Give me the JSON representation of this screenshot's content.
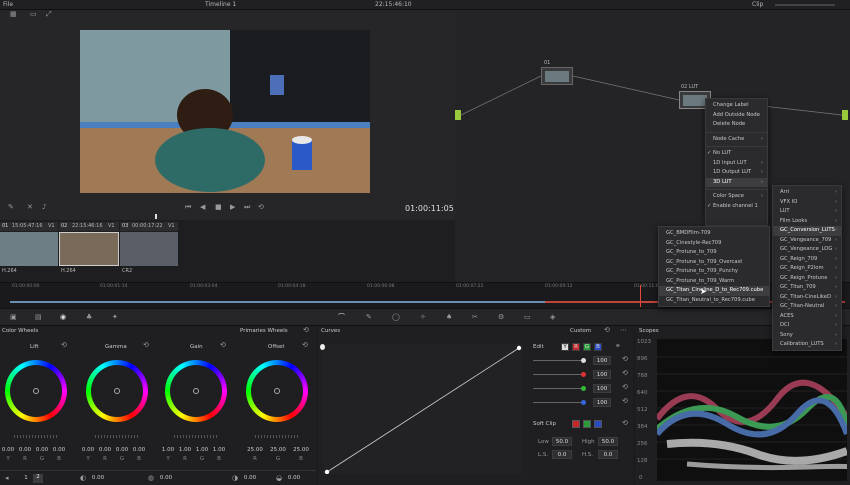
{
  "topbar": {
    "menu_label": "File",
    "timeline_title": "Timeline 1",
    "timecode": "22:15:46:10",
    "clip_label": "Clip"
  },
  "viewer": {
    "timecode": "01:00:11:05"
  },
  "nodes": {
    "node1_label": "01",
    "node2_label": "02 LUT"
  },
  "context_menu": {
    "items": [
      {
        "label": "Change Label",
        "sub": false
      },
      {
        "label": "Add Outside Node",
        "sub": false
      },
      {
        "label": "Delete Node",
        "sub": false
      },
      {
        "label": "Node Cache",
        "sub": true
      },
      {
        "label": "No LUT",
        "sub": false,
        "checked": true
      },
      {
        "label": "1D Input LUT",
        "sub": true
      },
      {
        "label": "1D Output LUT",
        "sub": true
      },
      {
        "label": "3D LUT",
        "sub": true
      },
      {
        "label": "Color Space",
        "sub": true
      },
      {
        "label": "Enable channel 1",
        "sub": false,
        "checked": true
      }
    ]
  },
  "lut_menu": {
    "items": [
      "Arri",
      "VFX IO",
      "LUT",
      "Film Looks",
      "GC_Conversion_LUTS",
      "GC_Vengeance_709",
      "GC_Vengeance_LOG",
      "GC_Reign_709",
      "GC_Reign_P2lom",
      "GC_Reign_Protune",
      "GC_Titan_709",
      "GC_Titan-CineLikeD",
      "GC_Titan-Neutral",
      "ACES",
      "DCI",
      "Sony",
      "Calibration_LUTS"
    ]
  },
  "cube_menu": {
    "items": [
      "GC_BMDFilm-709",
      "GC_Cinestyle-Rec709",
      "GC_Protune_to_709",
      "GC_Protune_to_709_Overcast",
      "GC_Protune_to_709_Punchy",
      "GC_Protune_to_709_Warm",
      "GC_Titan_Cineline_D_to_Rec709.cube",
      "GC_Titan_Neutral_to_Rec709.cube"
    ]
  },
  "clips": [
    {
      "num": "01",
      "tc": "15:05:47:16",
      "track": "V1",
      "codec": "H.264"
    },
    {
      "num": "02",
      "tc": "22:15:46:16",
      "track": "V1",
      "codec": "H.264"
    },
    {
      "num": "03",
      "tc": "00:00:17:22",
      "track": "V1",
      "codec": "CR2"
    }
  ],
  "timeline_ticks": [
    "01:00:00:00",
    "01:00:01:14",
    "01:00:03:04",
    "01:00:04:18",
    "01:00:06:08",
    "01:00:07:22",
    "01:00:09:12",
    "01:00:11:02"
  ],
  "color_wheels": {
    "title": "Color Wheels",
    "mode": "Primaries Wheels",
    "wheels": [
      {
        "name": "Lift",
        "values": [
          "0.00",
          "0.00",
          "0.00",
          "0.00"
        ]
      },
      {
        "name": "Gamma",
        "values": [
          "0.00",
          "0.00",
          "0.00",
          "0.00"
        ]
      },
      {
        "name": "Gain",
        "values": [
          "1.00",
          "1.00",
          "1.00",
          "1.00"
        ]
      },
      {
        "name": "Offset",
        "values": [
          "25.00",
          "25.00",
          "25.00"
        ]
      }
    ],
    "channels": [
      "Y",
      "R",
      "G",
      "B"
    ],
    "bottom_values": [
      "0.00",
      "0.00",
      "0.00",
      "0.00"
    ],
    "pages": [
      "1",
      "2"
    ]
  },
  "curves": {
    "title": "Curves",
    "mode": "Custom"
  },
  "edit": {
    "title": "Edit",
    "channels": [
      "Y",
      "R",
      "G",
      "B"
    ],
    "values": [
      "100",
      "100",
      "100",
      "100"
    ]
  },
  "softclip": {
    "title": "Soft Clip",
    "low_label": "Low",
    "low": "50.0",
    "high_label": "High",
    "high": "50.0",
    "ls_label": "L.S.",
    "ls": "0.0",
    "hs_label": "H.S.",
    "hs": "0.0"
  },
  "scopes": {
    "title": "Scopes",
    "ticks": [
      "1023",
      "896",
      "768",
      "640",
      "512",
      "384",
      "256",
      "128",
      "0"
    ]
  },
  "colors": {
    "accent": "#e8473c",
    "highlight": "#3d3d40",
    "node_green": "#9bc93c"
  }
}
